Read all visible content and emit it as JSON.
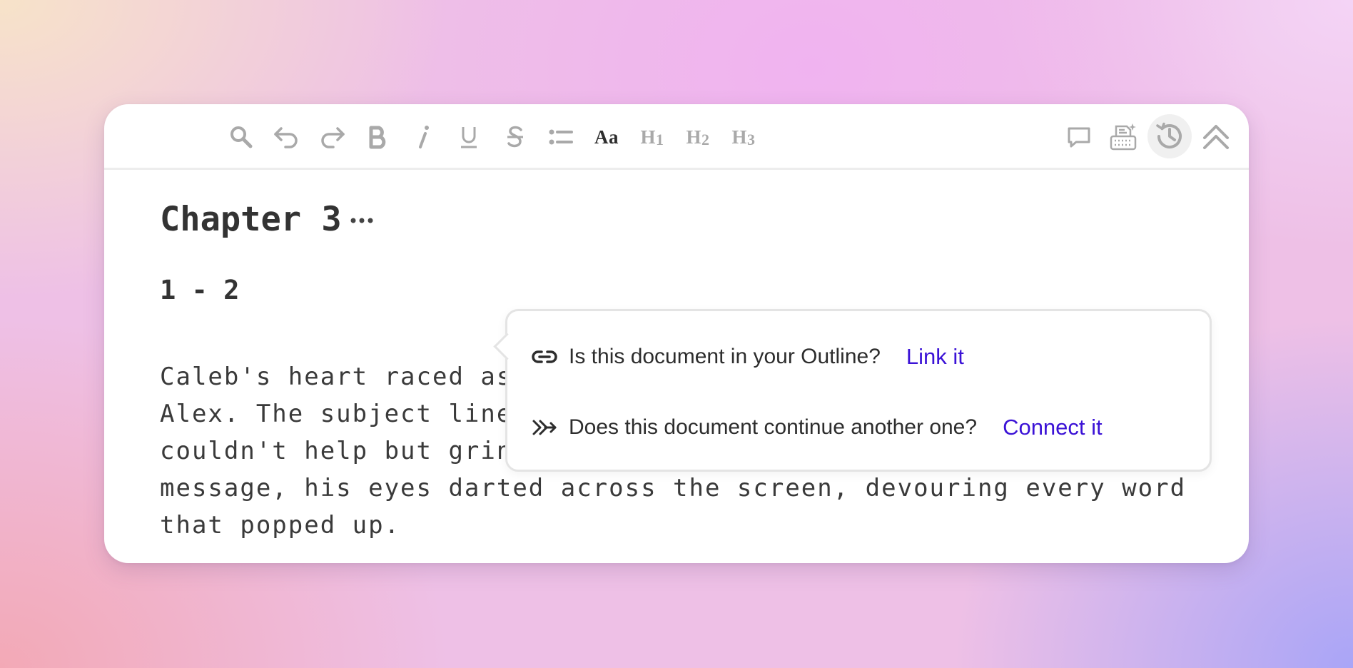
{
  "toolbar": {
    "left_tools": [
      {
        "name": "search-icon"
      },
      {
        "name": "undo-icon"
      },
      {
        "name": "redo-icon"
      },
      {
        "name": "bold-icon"
      },
      {
        "name": "italic-icon"
      },
      {
        "name": "underline-icon"
      },
      {
        "name": "strikethrough-icon"
      },
      {
        "name": "bullet-list-icon"
      }
    ],
    "font_label": "Aa",
    "h1_label": "H",
    "h1_sub": "1",
    "h2_label": "H",
    "h2_sub": "2",
    "h3_label": "H",
    "h3_sub": "3",
    "right_tools": [
      {
        "name": "comment-icon"
      },
      {
        "name": "typewriter-icon"
      },
      {
        "name": "history-icon",
        "active": true
      },
      {
        "name": "collapse-icon"
      }
    ]
  },
  "document": {
    "title": "Chapter 3",
    "subheading": "1 - 2",
    "paragraph": "Caleb's heart raced as he clicked on the email notification from Alex. The subject line read, \"The Midnight Gambit awaits you.\" He couldn't help but grin at the mysterious invitation. Opening the message, his eyes darted across the screen, devouring every word that popped up."
  },
  "popover": {
    "outline_prompt": "Is this document in your Outline?",
    "outline_action": "Link it",
    "continue_prompt": "Does this document continue another one?",
    "continue_action": "Connect it"
  },
  "colors": {
    "link": "#3b12d6",
    "toolbar_icon": "#a9a9a9",
    "toolbar_icon_active": "#2d2d2d",
    "text": "#333333"
  }
}
